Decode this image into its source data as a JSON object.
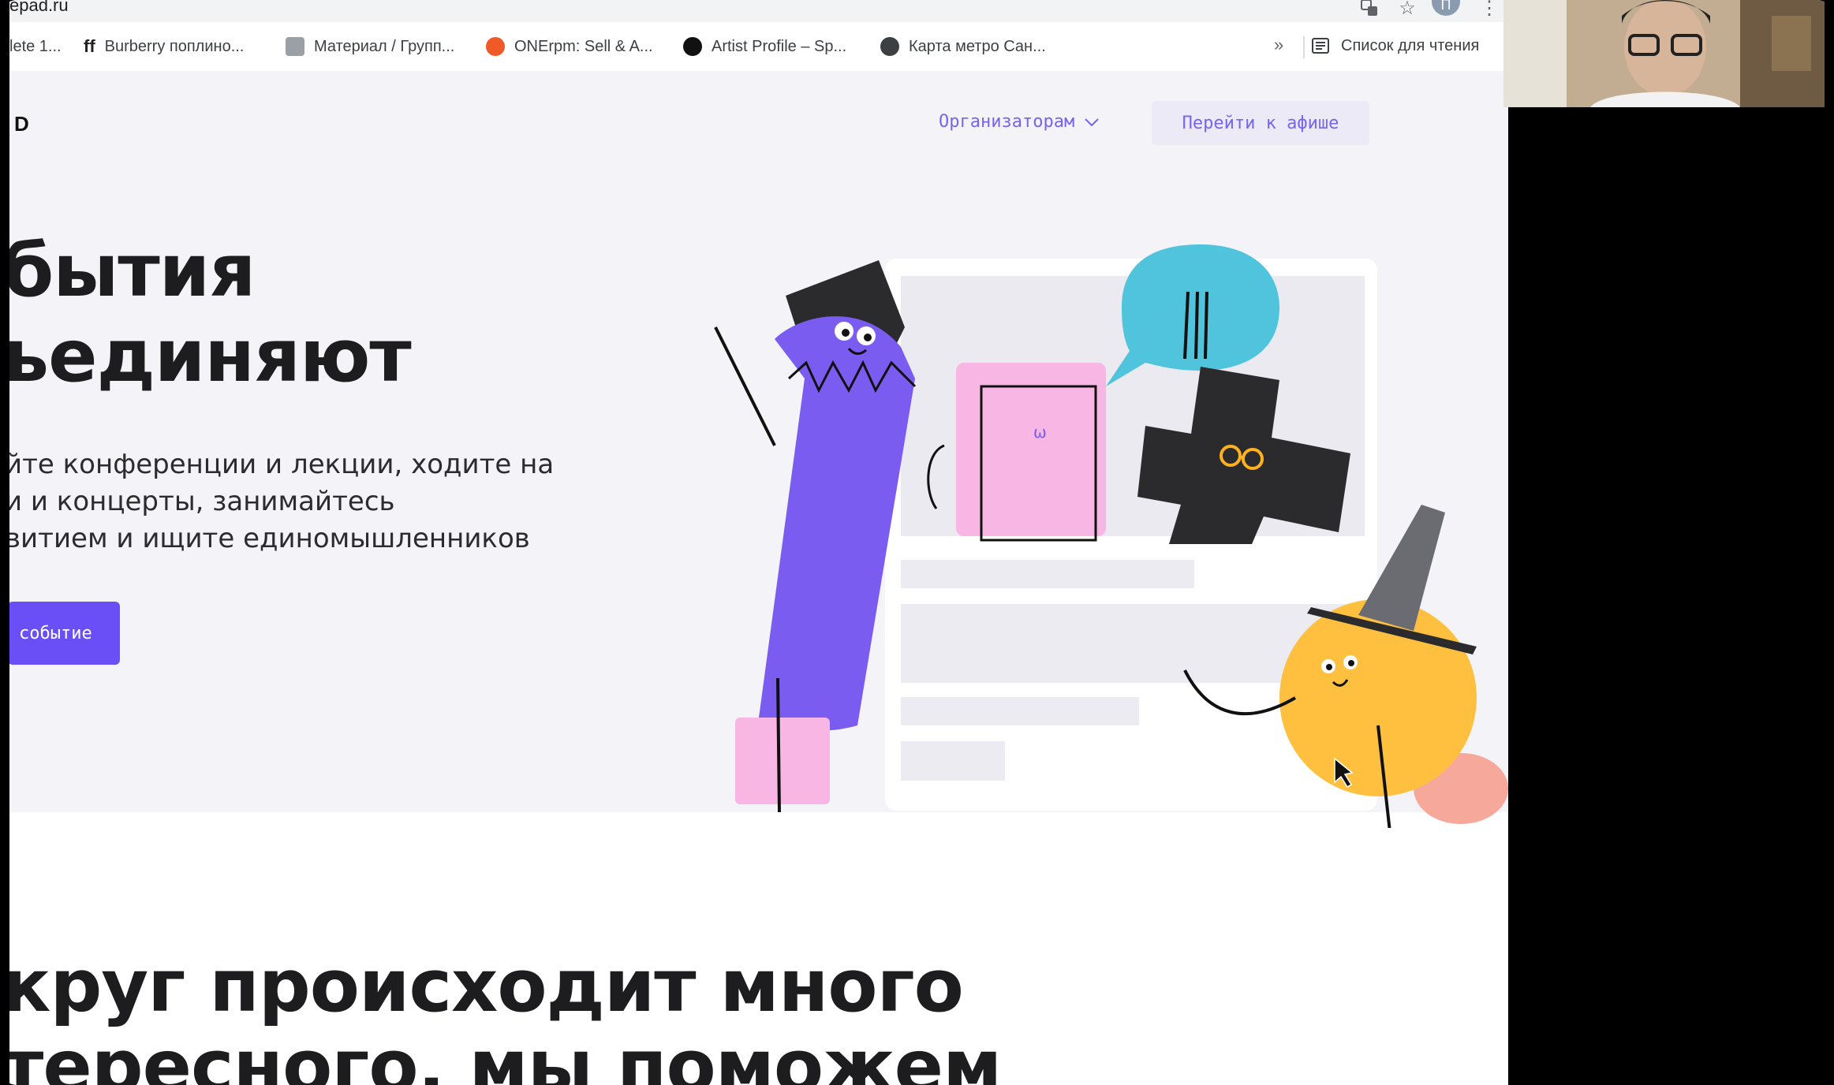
{
  "browser": {
    "url": "epad.ru",
    "profile_initial": "П",
    "bookmarks": [
      {
        "label": "lete 1...",
        "icon": "none"
      },
      {
        "label": "Burberry поплино...",
        "icon": "fashion-brand-icon"
      },
      {
        "label": "Материал / Групп...",
        "icon": "document-icon"
      },
      {
        "label": "ONErpm: Sell & A...",
        "icon": "onerpm-icon"
      },
      {
        "label": "Artist Profile – Sp...",
        "icon": "spotify-icon"
      },
      {
        "label": "Карта метро Сан...",
        "icon": "globe-icon"
      }
    ],
    "more_label": "»",
    "reading_list_label": "Список для чтения"
  },
  "site": {
    "logo": "D",
    "nav": {
      "organizers_label": "Организаторам",
      "poster_button": "Перейти к афише"
    },
    "hero": {
      "title_line1": "бытия",
      "title_line2": "ьединяют",
      "lead_line1": "йте конференции и лекции, ходите на",
      "lead_line2": "и и концерты, занимайтесь",
      "lead_line3": "витием и ищите единомышленников",
      "cta_label": "событие"
    },
    "section2": {
      "title_line1": "круг происходит много",
      "title_line2": "тересного, мы поможем"
    }
  },
  "colors": {
    "accent": "#6a4ff7",
    "nav_text": "#7665f0",
    "hero_bg": "#f4f3f7",
    "pencil": "#7a5cf0",
    "bubble": "#4fc4dc",
    "ball": "#ffbf3f",
    "pink": "#f8b6e4"
  }
}
